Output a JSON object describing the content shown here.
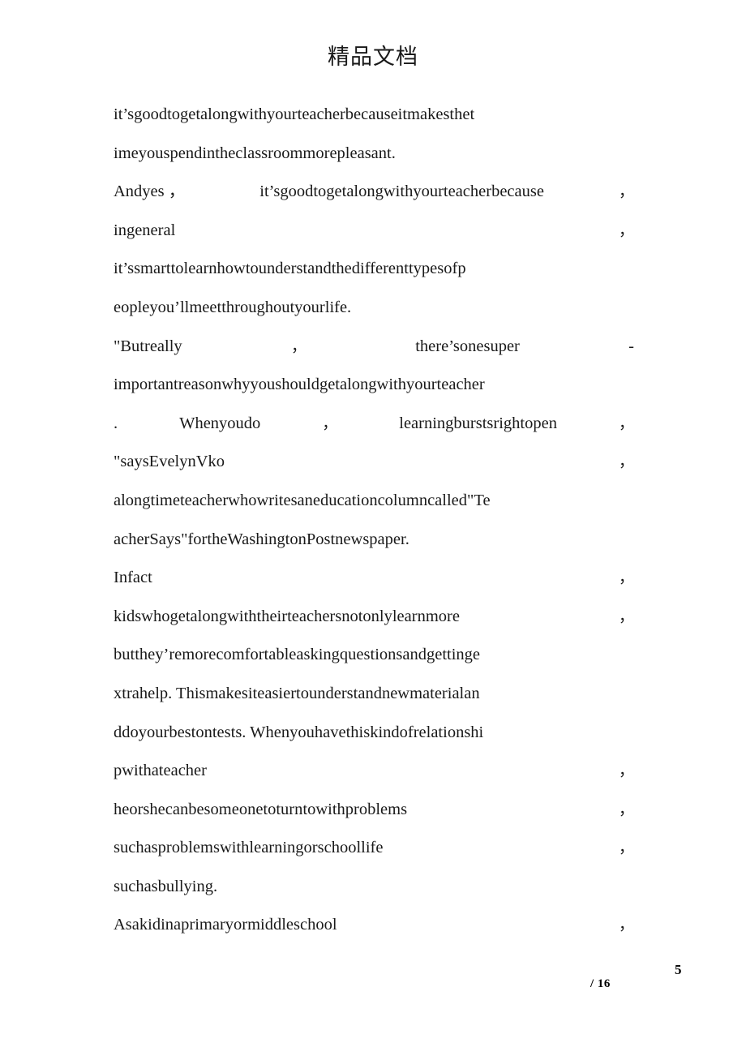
{
  "header": {
    "watermark_title": "精品文档"
  },
  "document": {
    "lines": [
      {
        "id": "line-1",
        "layout": "plain",
        "runs": [
          "it’sgoodtogetalongwithyourteacherbecauseitmakesthet"
        ]
      },
      {
        "id": "line-2",
        "layout": "plain",
        "runs": [
          "imeyouspendintheclassroommorepleasant."
        ]
      },
      {
        "id": "line-3",
        "layout": "spread",
        "runs": [
          "Andyes ，",
          "it’sgoodtogetalongwithyourteacherbecause",
          "，"
        ]
      },
      {
        "id": "line-4",
        "layout": "split",
        "runs": [
          "ingeneral",
          "，"
        ]
      },
      {
        "id": "line-5",
        "layout": "plain",
        "runs": [
          "it’ssmarttolearnhowtounderstandthedifferenttypesofp"
        ]
      },
      {
        "id": "line-6",
        "layout": "plain",
        "runs": [
          "eopleyou’llmeetthroughoutyourlife."
        ]
      },
      {
        "id": "line-7",
        "layout": "spread",
        "runs": [
          "\"Butreally",
          "，",
          "there’sonesuper",
          "-"
        ]
      },
      {
        "id": "line-8",
        "layout": "plain",
        "runs": [
          "importantreasonwhyyoushouldgetalongwithyourteacher"
        ]
      },
      {
        "id": "line-9",
        "layout": "spread",
        "runs": [
          ".",
          "Whenyoudo",
          "，",
          "learningburstsrightopen",
          "，"
        ]
      },
      {
        "id": "line-10",
        "layout": "split",
        "runs": [
          "\"saysEvelynVko",
          "，"
        ]
      },
      {
        "id": "line-11",
        "layout": "plain",
        "runs": [
          "alongtimeteacherwhowritesaneducationcolumncalled\"Te"
        ]
      },
      {
        "id": "line-12",
        "layout": "plain",
        "runs": [
          "acherSays\"fortheWashingtonPostnewspaper."
        ]
      },
      {
        "id": "line-13",
        "layout": "split",
        "runs": [
          "Infact",
          "，"
        ]
      },
      {
        "id": "line-14",
        "layout": "split",
        "runs": [
          "kidswhogetalongwiththeirteachersnotonlylearnmore",
          "，"
        ]
      },
      {
        "id": "line-15",
        "layout": "plain",
        "runs": [
          "butthey’remorecomfortableaskingquestionsandgettinge"
        ]
      },
      {
        "id": "line-16",
        "layout": "plain",
        "runs": [
          "xtrahelp. Thismakesiteasiertounderstandnewmaterialan"
        ]
      },
      {
        "id": "line-17",
        "layout": "plain",
        "runs": [
          "ddoyourbestontests. Whenyouhavethiskindofrelationshi"
        ]
      },
      {
        "id": "line-18",
        "layout": "split",
        "runs": [
          "pwithateacher",
          "，"
        ]
      },
      {
        "id": "line-19",
        "layout": "split",
        "runs": [
          "heorshecanbesomeonetoturntowithproblems",
          "，"
        ]
      },
      {
        "id": "line-20",
        "layout": "split",
        "runs": [
          "suchasproblemswithlearningorschoollife",
          "，"
        ]
      },
      {
        "id": "line-21",
        "layout": "plain",
        "runs": [
          "suchasbullying."
        ]
      },
      {
        "id": "line-22",
        "layout": "split",
        "runs": [
          "Asakidinaprimaryormiddleschool",
          "，"
        ]
      }
    ]
  },
  "footer": {
    "current_page": "5",
    "total_pages": "/ 16"
  }
}
